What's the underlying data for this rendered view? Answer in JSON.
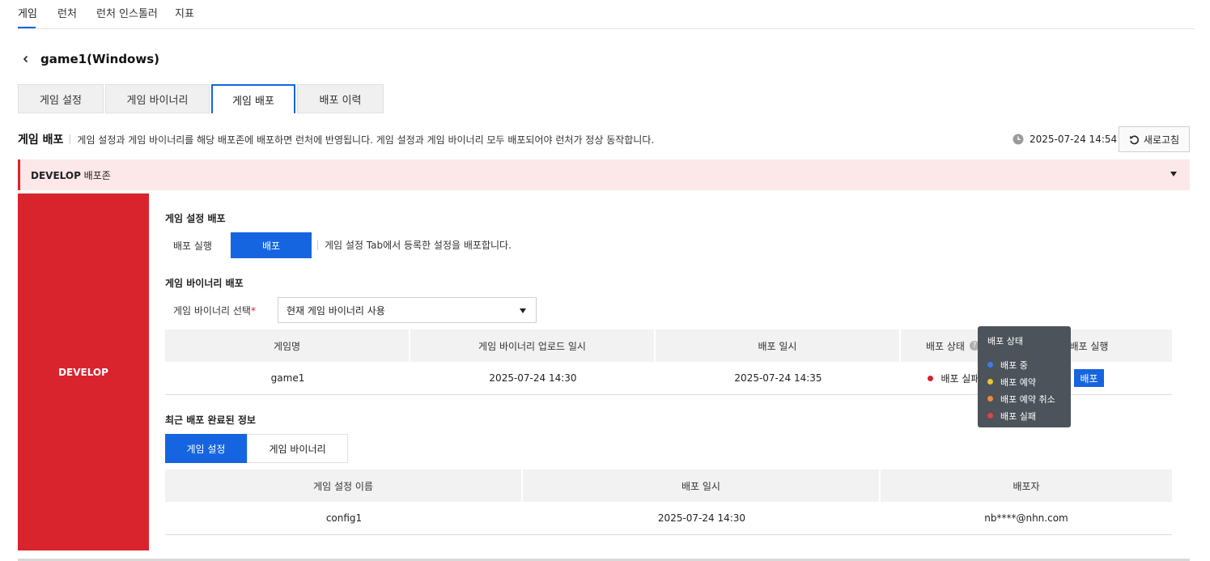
{
  "nav": {
    "tabs": [
      {
        "label": "게임"
      },
      {
        "label": "런처"
      },
      {
        "label": "런처 인스톨러"
      },
      {
        "label": "지표"
      }
    ]
  },
  "page": {
    "title": "game1(Windows)"
  },
  "subtabs": [
    {
      "label": "게임 설정"
    },
    {
      "label": "게임 바이너리"
    },
    {
      "label": "게임 배포"
    },
    {
      "label": "배포 이력"
    }
  ],
  "section": {
    "title": "게임 배포",
    "description": "게임 설정과 게임 바이너리를 해당 배포존에 배포하면 런처에 반영됩니다. 게임 설정과 게임 바이너리 모두 배포되어야 런처가 정상 동작합니다.",
    "timestamp": "2025-07-24 14:54",
    "refresh_label": "새로고침"
  },
  "zone": {
    "name": "DEVELOP",
    "suffix": " 배포존",
    "side_label": "DEVELOP",
    "accent_color": "#d9232d"
  },
  "config_deploy": {
    "heading": "게임 설정 배포",
    "run_label": "배포 실행",
    "button_label": "배포",
    "note": "게임 설정 Tab에서 등록한 설정을 배포합니다."
  },
  "binary_deploy": {
    "heading": "게임 바이너리 배포",
    "select_label": "게임 바이너리 선택",
    "required_mark": "*",
    "select_value": "현재 게임 바이너리 사용",
    "columns": [
      "게임명",
      "게임 바이너리 업로드 일시",
      "배포 일시",
      "배포 상태",
      "배포 실행"
    ],
    "rows": [
      {
        "name": "game1",
        "uploaded": "2025-07-24 14:30",
        "deployed": "2025-07-24 14:35",
        "status": "배포 실패",
        "action": "배포"
      }
    ]
  },
  "tooltip": {
    "title": "배포 상태",
    "items": [
      {
        "label": "배포 중",
        "color": "#3d7bf0"
      },
      {
        "label": "배포 예약",
        "color": "#f2c230"
      },
      {
        "label": "배포 예약 취소",
        "color": "#f08a3c"
      },
      {
        "label": "배포 실패",
        "color": "#e0404a"
      }
    ]
  },
  "recent": {
    "heading": "최근 배포 완료된 정보",
    "tabs": [
      {
        "label": "게임 설정"
      },
      {
        "label": "게임 바이너리"
      }
    ],
    "columns": [
      "게임 설정 이름",
      "배포 일시",
      "배포자"
    ],
    "rows": [
      {
        "name": "config1",
        "deployed": "2025-07-24 14:30",
        "deployer": "nb****@nhn.com"
      }
    ]
  }
}
